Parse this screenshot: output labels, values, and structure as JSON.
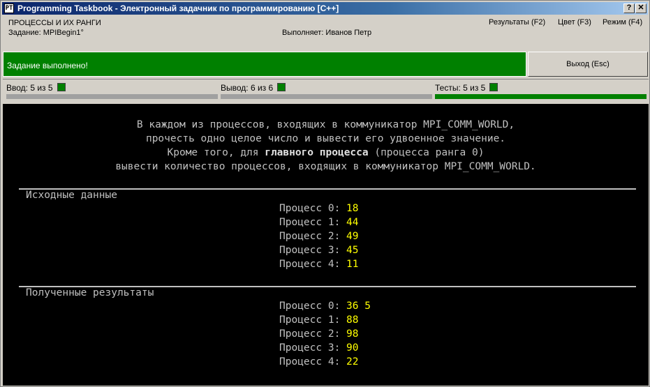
{
  "window": {
    "title": "Programming Taskbook - Электронный задачник по программированию [C++]",
    "icon_glyph": "PT",
    "help_label": "?",
    "close_label": "✕"
  },
  "header": {
    "group": "ПРОЦЕССЫ И ИХ РАНГИ",
    "task": "Задание: MPIBegin1°",
    "performer": "Выполняет: Иванов Петр",
    "menu": [
      "Результаты (F2)",
      "Цвет (F3)",
      "Режим (F4)"
    ]
  },
  "status": {
    "message": "Задание выполнено!",
    "color": "#008000",
    "exit_label": "Выход (Esc)"
  },
  "progress": [
    {
      "label": "Ввод: 5 из 5",
      "fill": 0
    },
    {
      "label": "Вывод: 6 из 6",
      "fill": 0
    },
    {
      "label": "Тесты: 5 из 5",
      "fill": 1
    }
  ],
  "task_text": {
    "line1": "В каждом из процессов, входящих в коммуникатор MPI_COMM_WORLD,",
    "line2": "прочесть одно целое число и вывести его удвоенное значение.",
    "line3_pre": "Кроме того, для ",
    "line3_bold": "главного процесса",
    "line3_post": " (процесса ранга 0)",
    "line4": "вывести количество процессов, входящих в коммуникатор MPI_COMM_WORLD."
  },
  "input_section": {
    "title": "Исходные данные",
    "rows": [
      {
        "label": "Процесс 0:",
        "value": "18"
      },
      {
        "label": "Процесс 1:",
        "value": "44"
      },
      {
        "label": "Процесс 2:",
        "value": "49"
      },
      {
        "label": "Процесс 3:",
        "value": "45"
      },
      {
        "label": "Процесс 4:",
        "value": "11"
      }
    ]
  },
  "output_section": {
    "title": "Полученные результаты",
    "rows": [
      {
        "label": "Процесс 0:",
        "value": "36 5"
      },
      {
        "label": "Процесс 1:",
        "value": "88"
      },
      {
        "label": "Процесс 2:",
        "value": "98"
      },
      {
        "label": "Процесс 3:",
        "value": "90"
      },
      {
        "label": "Процесс 4:",
        "value": "22"
      }
    ]
  }
}
